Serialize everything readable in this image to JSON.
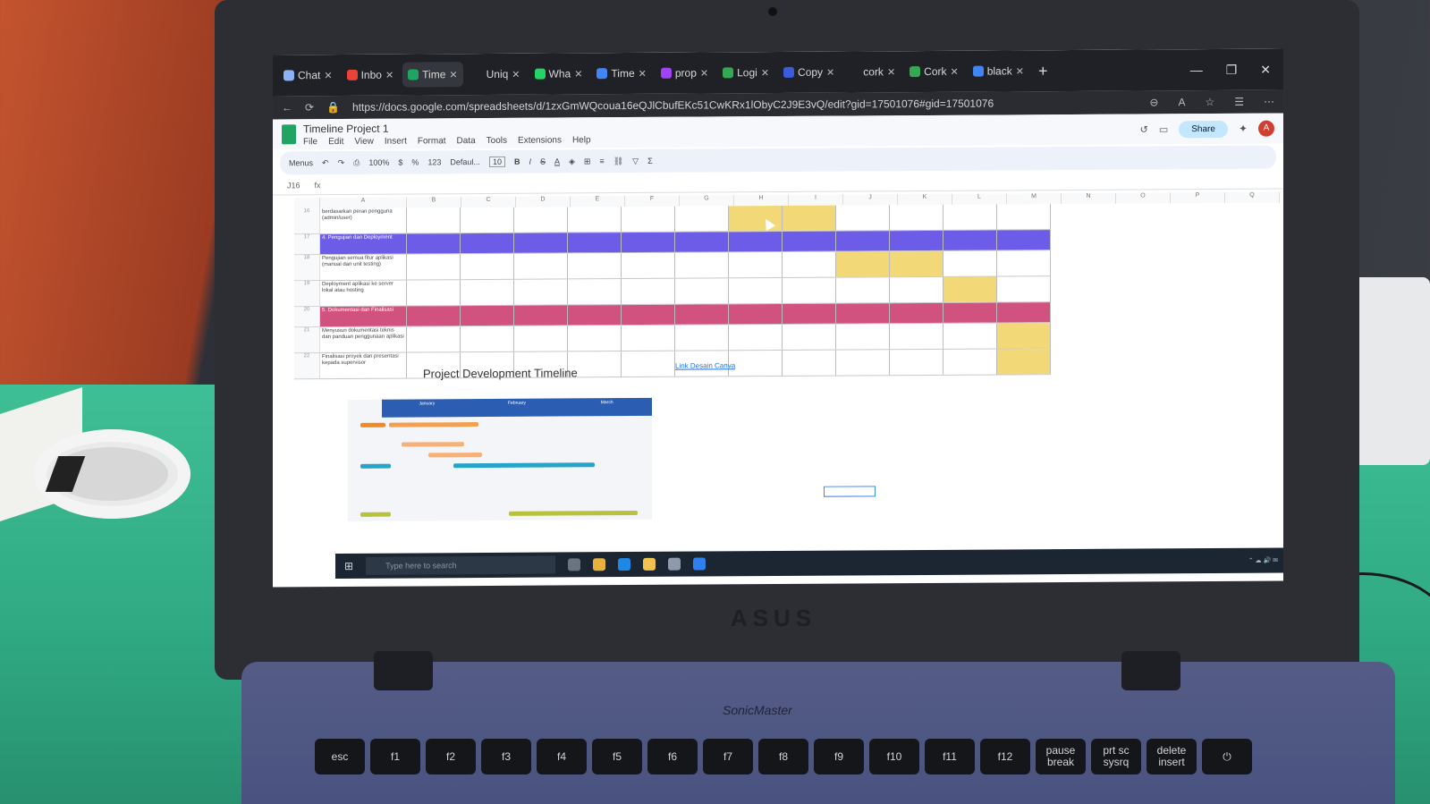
{
  "browser": {
    "tabs": [
      {
        "label": "Chat",
        "color": "#8ab4f8"
      },
      {
        "label": "Inbo",
        "color": "#ea4335"
      },
      {
        "label": "Time",
        "color": "#1fa463",
        "active": true
      },
      {
        "label": "Uniq",
        "color": "#202124"
      },
      {
        "label": "Wha",
        "color": "#25d366"
      },
      {
        "label": "Time",
        "color": "#4285f4"
      },
      {
        "label": "prop",
        "color": "#a142f4"
      },
      {
        "label": "Logi",
        "color": "#34a853"
      },
      {
        "label": "Copy",
        "color": "#3b5bdb"
      },
      {
        "label": "cork",
        "color": "#202124"
      },
      {
        "label": "Cork",
        "color": "#34a853"
      },
      {
        "label": "black",
        "color": "#4285f4"
      }
    ],
    "new_tab": "+",
    "url": "https://docs.google.com/spreadsheets/d/1zxGmWQcoua16eQJlCbufEKc51CwKRx1lObyC2J9E3vQ/edit?gid=17501076#gid=17501076"
  },
  "sheets": {
    "doc_title": "Timeline Project 1",
    "menu": [
      "File",
      "Edit",
      "View",
      "Insert",
      "Format",
      "Data",
      "Tools",
      "Extensions",
      "Help"
    ],
    "share_label": "Share",
    "avatar_letter": "A",
    "toolbar": {
      "menus": "Menus",
      "zoom": "100%",
      "currency": "$",
      "percent": "%",
      "decimals": "123",
      "font": "Defaul...",
      "font_size": "10",
      "bold": "B",
      "italic": "I",
      "strike": "S",
      "text_color": "A"
    },
    "name_box": "J16",
    "fx": "fx",
    "columns": [
      "A",
      "B",
      "C",
      "D",
      "E",
      "F",
      "G",
      "H",
      "I",
      "J",
      "K",
      "L",
      "M",
      "N",
      "O",
      "P",
      "Q"
    ],
    "rows": [
      {
        "num": "16",
        "task": "berdasarkan peran pengguna (admin/user)",
        "fill": [
          0,
          0,
          0,
          0,
          0,
          0,
          "y",
          "y",
          0,
          0,
          0,
          0
        ]
      },
      {
        "num": "17",
        "task": "4. Pengujian dan Deployment",
        "fill": "p"
      },
      {
        "num": "18",
        "task": "Pengujian semua fitur aplikasi (manual dan unit testing)",
        "fill": [
          0,
          0,
          0,
          0,
          0,
          0,
          0,
          0,
          "y",
          "y",
          0,
          0
        ]
      },
      {
        "num": "19",
        "task": "Deployment aplikasi ke server lokal atau hosting",
        "fill": [
          0,
          0,
          0,
          0,
          0,
          0,
          0,
          0,
          0,
          0,
          "y",
          0
        ]
      },
      {
        "num": "20",
        "task": "5. Dokumentasi dan Finalisasi",
        "fill": "pk"
      },
      {
        "num": "21",
        "task": "Menyusun dokumentasi teknis dan panduan penggunaan aplikasi",
        "fill": [
          0,
          0,
          0,
          0,
          0,
          0,
          0,
          0,
          0,
          0,
          0,
          "y"
        ]
      },
      {
        "num": "22",
        "task": "Finalisasi proyek dan presentasi kepada supervisor",
        "fill": [
          0,
          0,
          0,
          0,
          0,
          0,
          0,
          0,
          0,
          0,
          0,
          "y"
        ]
      }
    ],
    "chart_title": "Project Development Timeline",
    "chart_link": "Link Desain Canva",
    "mini_months": [
      "January",
      "February",
      "March"
    ]
  },
  "taskbar": {
    "search_placeholder": "Type here to search"
  },
  "laptop": {
    "brand": "ASUS",
    "sonicmaster": "SonicMaster"
  },
  "keyboard": [
    "esc",
    "f1",
    "f2",
    "f3",
    "f4",
    "f5",
    "f6",
    "f7",
    "f8",
    "f9",
    "f10",
    "f11",
    "f12",
    "pause break",
    "prt sc sysrq",
    "delete insert",
    "⏻"
  ]
}
